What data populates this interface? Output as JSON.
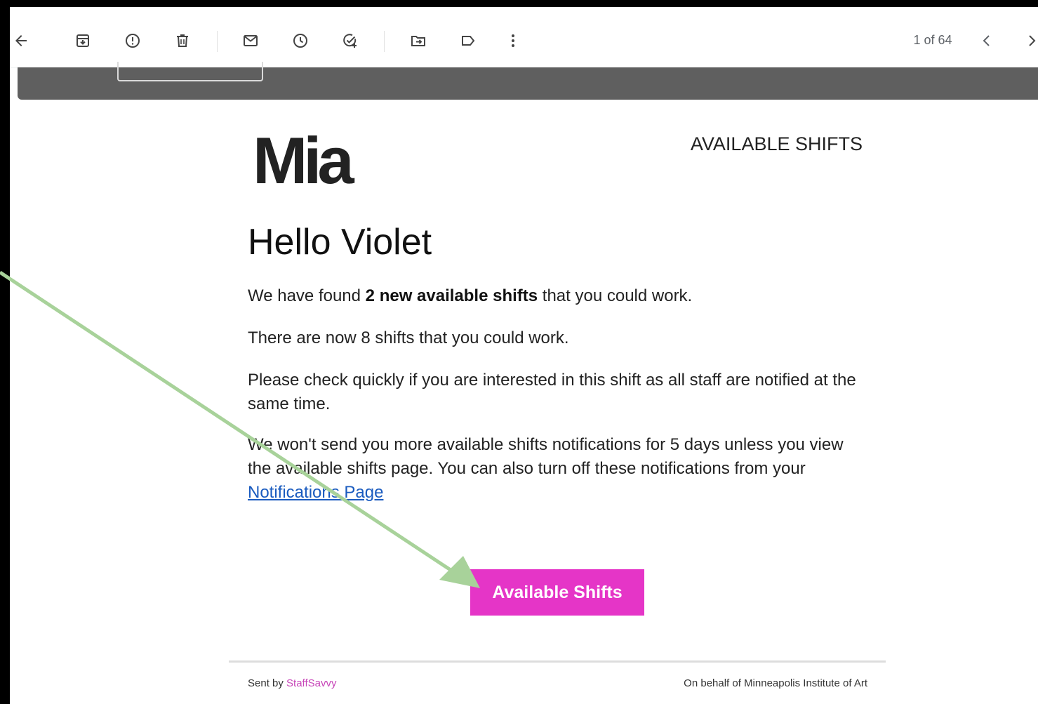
{
  "toolbar": {
    "icons": [
      "back-arrow-icon",
      "archive-icon",
      "report-spam-icon",
      "delete-icon",
      "mark-unread-icon",
      "snooze-icon",
      "add-task-icon",
      "move-to-icon",
      "label-icon",
      "more-options-icon"
    ],
    "pager_text": "1 of 64"
  },
  "email": {
    "logo_text": "Mia",
    "header_tag": "AVAILABLE SHIFTS",
    "greeting": "Hello Violet",
    "p1_before": "We have found ",
    "p1_bold": "2 new available shifts",
    "p1_after": " that you could work.",
    "p2": "There are now 8 shifts that you could work.",
    "p3": "Please check quickly if you are interested in this shift as all staff are notified at the same time.",
    "p4_text": "We won't send you more available shifts notifications for 5 days unless you view the available shifts page. You can also turn off these notifications from your ",
    "p4_link": "Notifications Page",
    "cta_label": "Available Shifts",
    "footer_sent_by": "Sent by ",
    "footer_brand": "StaffSavvy",
    "footer_behalf": "On behalf of Minneapolis Institute of Art"
  },
  "colors": {
    "cta": "#e535c7",
    "banner": "#5f5f5f",
    "link": "#1a5bbf",
    "arrow": "#a8d29a"
  }
}
